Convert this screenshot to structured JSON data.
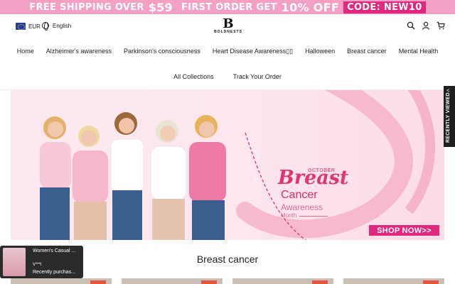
{
  "promo": {
    "free_shipping": "FREE SHIPPING OVER",
    "threshold": "$59",
    "first_order": "FIRST ORDER GET",
    "discount": "10% OFF",
    "code": "CODE: NEW10",
    "bg_color": "#f3a0c4",
    "code_color": "#e2277f"
  },
  "header": {
    "currency": "EUR",
    "language": "English",
    "logo_text": "BOLDNESTS",
    "icons": [
      "search-icon",
      "account-icon",
      "cart-icon"
    ]
  },
  "nav": {
    "row1": [
      "Home",
      "Alzheimer's awareness",
      "Parkinson's consciousness",
      "Heart Disease Awareness▯▯",
      "Halloween",
      "Breast cancer",
      "Mental Health"
    ],
    "row2": [
      "All Collections",
      "Track Your Order"
    ]
  },
  "hero": {
    "october": "OCTOBER",
    "breast": "Breast",
    "cancer": "Cancer",
    "awareness": "Awareness",
    "month": "Month",
    "cta": "SHOP NOW>>"
  },
  "recently_viewed": {
    "label": "RECENTLY VIEWED",
    "chevron": "<"
  },
  "section": {
    "title": "Breast cancer"
  },
  "toast": {
    "product": "Women's Casual ...",
    "buyer": "V***l",
    "status": "Recently purchas..."
  }
}
